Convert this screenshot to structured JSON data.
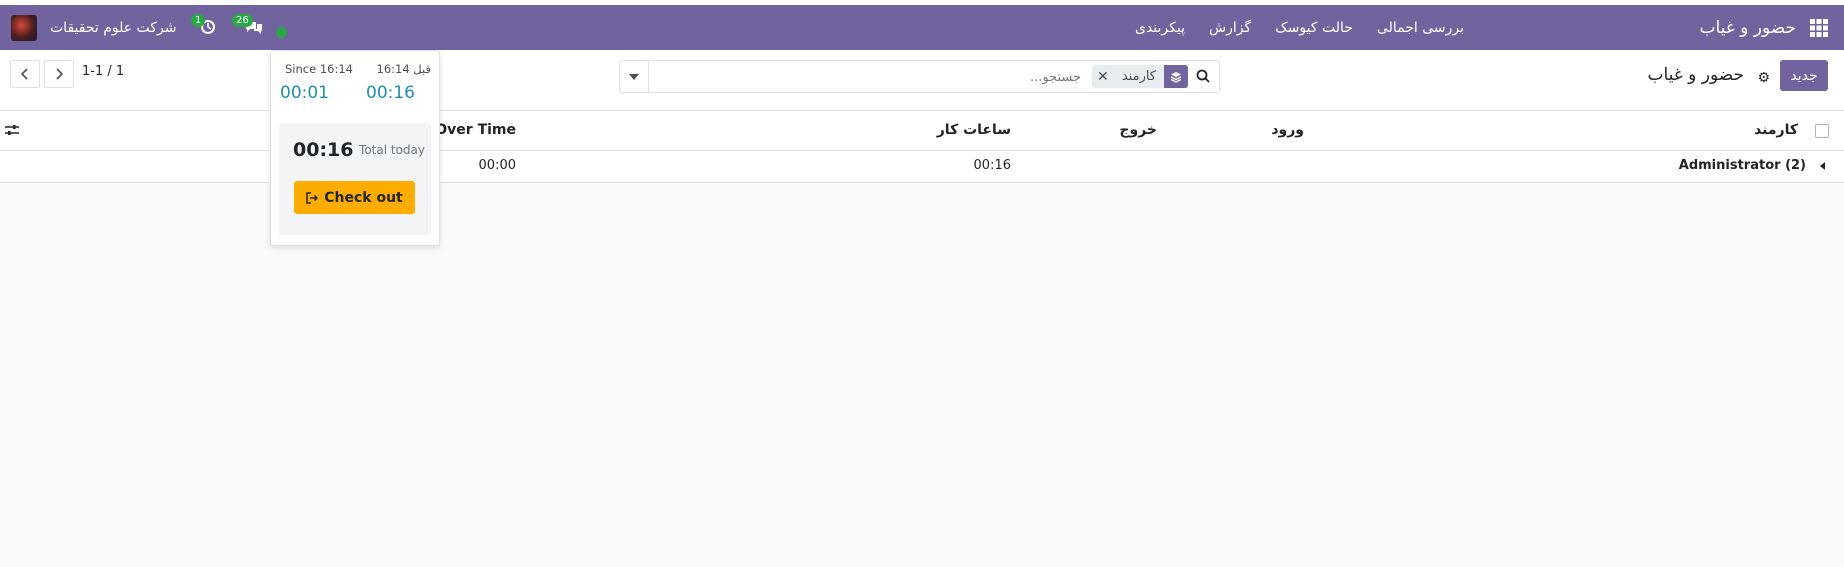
{
  "navbar": {
    "app_title": "حضور و غیاب",
    "menu": [
      "بررسی اجمالی",
      "حالت کیوسک",
      "گزارش",
      "پیکربندی"
    ],
    "company": "شرکت علوم تحقیقات",
    "messages_count": "26",
    "activities_count": "1",
    "colors": {
      "navbar": "#71639e",
      "presence": "#28a745"
    }
  },
  "control_panel": {
    "new_label": "جدید",
    "title": "حضور و غیاب",
    "search": {
      "placeholder": "جستجو...",
      "facet_label": "کارمند"
    },
    "pager": {
      "value": "1-1 / 1"
    }
  },
  "table": {
    "headers": {
      "employee": "کارمند",
      "check_in": "ورود",
      "check_out": "خروج",
      "worked_hours": "ساعات کار",
      "over_time": "Over Time"
    },
    "group_row": {
      "label": "Administrator (2)",
      "worked_hours": "00:16",
      "over_time": "00:00"
    }
  },
  "popover": {
    "before_label": "قبل 16:14",
    "before_value": "00:16",
    "since_label": "Since 16:14",
    "since_value": "00:01",
    "total_value": "00:16",
    "total_label": "Total today",
    "checkout_label": "Check out",
    "colors": {
      "button": "#ffac00",
      "value": "#1f8eb0"
    }
  }
}
